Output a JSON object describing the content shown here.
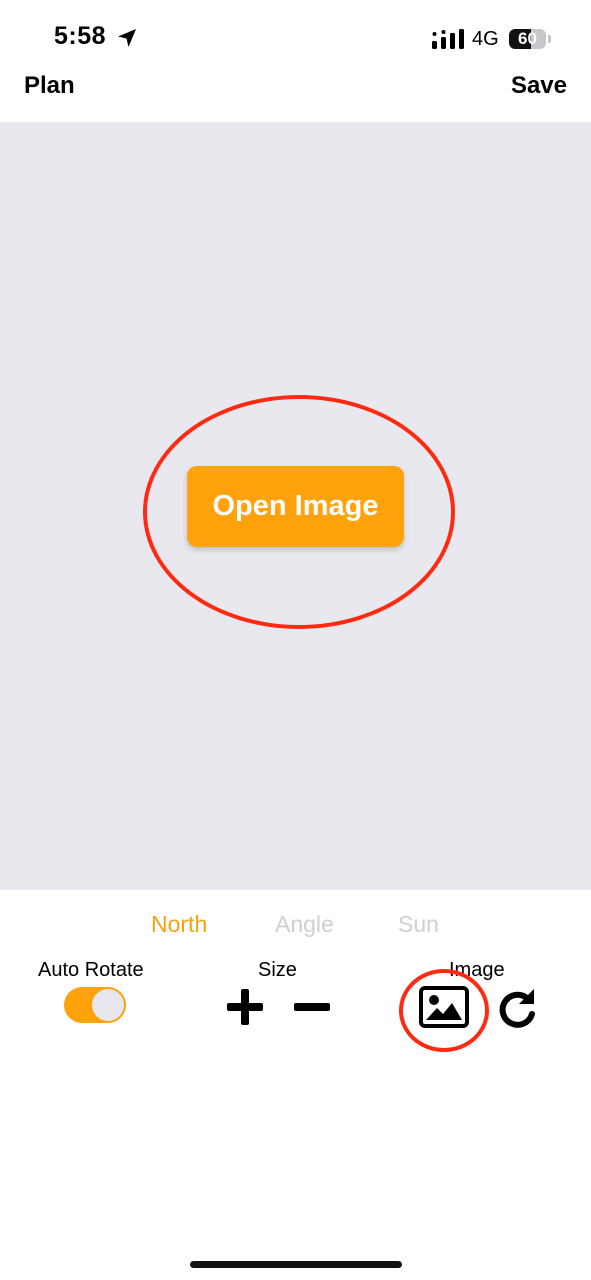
{
  "status_bar": {
    "time": "5:58",
    "network": "4G",
    "battery_level": "60",
    "battery_fraction": 0.6
  },
  "nav": {
    "left_label": "Plan",
    "right_label": "Save"
  },
  "canvas": {
    "open_image_label": "Open Image"
  },
  "segments": {
    "north": "North",
    "angle": "Angle",
    "sun": "Sun",
    "selected": "North"
  },
  "controls": {
    "auto_rotate_label": "Auto Rotate",
    "auto_rotate_on": true,
    "size_label": "Size",
    "image_label": "Image"
  },
  "icons": [
    "location-arrow-icon",
    "signal-icon",
    "battery-icon",
    "plus-icon",
    "minus-icon",
    "image-icon",
    "rotate-icon"
  ],
  "colors": {
    "accent": "#ffa20b",
    "annotation": "#ff2a12",
    "canvas": "#e9e8ee",
    "inactive": "#cfcfd2"
  }
}
